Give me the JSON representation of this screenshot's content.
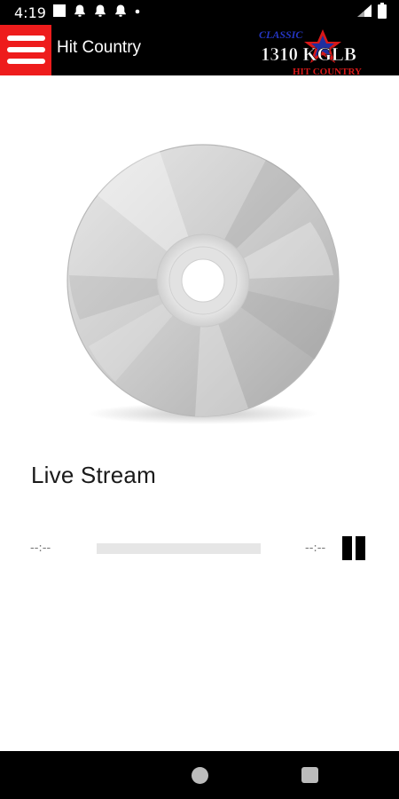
{
  "status_bar": {
    "time": "4:19",
    "icons_left": [
      "square-notification-icon",
      "bell-icon",
      "bell-icon",
      "bell-icon",
      "dot-icon"
    ],
    "icons_right": [
      "signal-icon",
      "battery-icon"
    ]
  },
  "app_bar": {
    "title": "Hit Country",
    "menu_icon": "hamburger-menu-icon",
    "logo": {
      "top_text": "CLASSIC",
      "main_text": "1310 KGLB",
      "bottom_text": "HIT COUNTRY"
    }
  },
  "player": {
    "album_art": "cd-disc-image",
    "track_title": "Live Stream",
    "time_elapsed": "--:--",
    "time_total": "--:--",
    "progress": 0,
    "control_icon": "pause-icon"
  },
  "nav_bar": {
    "home_icon": "home-circle-icon",
    "recents_icon": "recents-square-icon"
  },
  "colors": {
    "menu_button_bg": "#ee1c1c",
    "bar_bg": "#000000",
    "logo_blue": "#1f2f9f",
    "logo_red": "#d81818"
  }
}
